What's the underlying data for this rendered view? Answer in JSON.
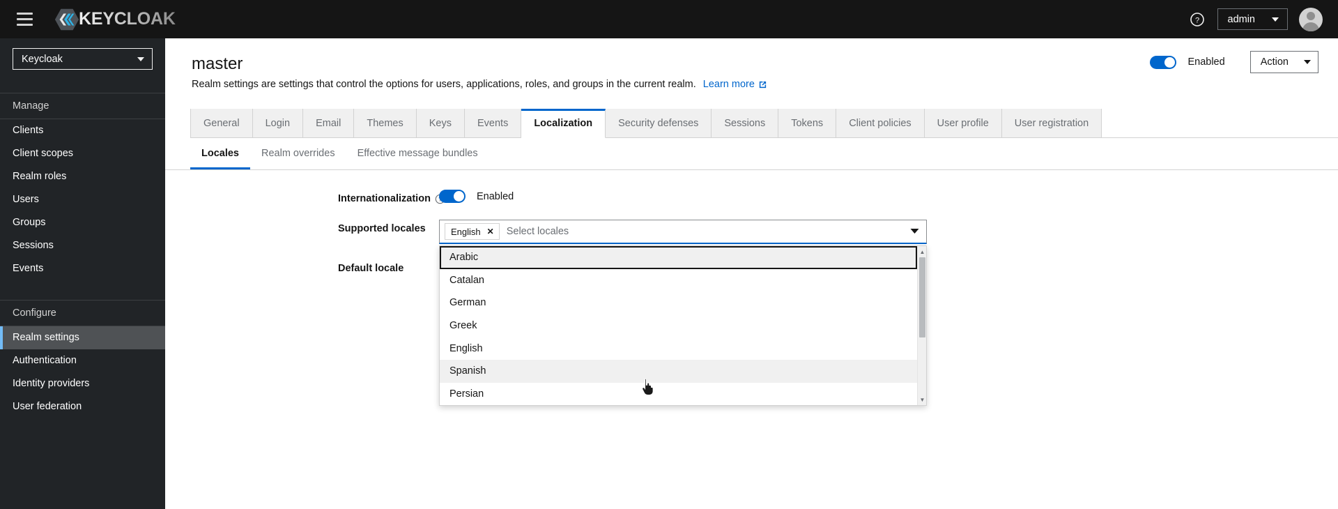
{
  "masthead": {
    "hamburger_icon": "hamburger-menu-icon",
    "brand_text": "KEYCLOAK",
    "brand_logo_icon": "keycloak-logo-icon",
    "help_icon": "help-circle-icon",
    "user_name": "admin",
    "user_caret_icon": "chevron-down-icon",
    "avatar_icon": "user-avatar-icon"
  },
  "sidebar": {
    "realm_selector": {
      "value": "Keycloak",
      "caret_icon": "chevron-down-icon"
    },
    "sections": [
      {
        "title": "Manage",
        "items": [
          {
            "label": "Clients",
            "active": false
          },
          {
            "label": "Client scopes",
            "active": false
          },
          {
            "label": "Realm roles",
            "active": false
          },
          {
            "label": "Users",
            "active": false
          },
          {
            "label": "Groups",
            "active": false
          },
          {
            "label": "Sessions",
            "active": false
          },
          {
            "label": "Events",
            "active": false
          }
        ]
      },
      {
        "title": "Configure",
        "items": [
          {
            "label": "Realm settings",
            "active": true
          },
          {
            "label": "Authentication",
            "active": false
          },
          {
            "label": "Identity providers",
            "active": false
          },
          {
            "label": "User federation",
            "active": false
          }
        ]
      }
    ]
  },
  "page": {
    "title": "master",
    "description": "Realm settings are settings that control the options for users, applications, roles, and groups in the current realm.",
    "learn_more_label": "Learn more",
    "learn_more_icon": "external-link-icon",
    "enabled_label": "Enabled",
    "enabled_state": true,
    "action_label": "Action",
    "action_caret_icon": "chevron-down-icon"
  },
  "tabs": [
    {
      "label": "General",
      "active": false
    },
    {
      "label": "Login",
      "active": false
    },
    {
      "label": "Email",
      "active": false
    },
    {
      "label": "Themes",
      "active": false
    },
    {
      "label": "Keys",
      "active": false
    },
    {
      "label": "Events",
      "active": false
    },
    {
      "label": "Localization",
      "active": true
    },
    {
      "label": "Security defenses",
      "active": false
    },
    {
      "label": "Sessions",
      "active": false
    },
    {
      "label": "Tokens",
      "active": false
    },
    {
      "label": "Client policies",
      "active": false
    },
    {
      "label": "User profile",
      "active": false
    },
    {
      "label": "User registration",
      "active": false
    }
  ],
  "subtabs": [
    {
      "label": "Locales",
      "active": true
    },
    {
      "label": "Realm overrides",
      "active": false
    },
    {
      "label": "Effective message bundles",
      "active": false
    }
  ],
  "form": {
    "internationalization": {
      "label": "Internationalization",
      "help_icon": "help-circle-icon",
      "toggle_state": true,
      "toggle_label": "Enabled"
    },
    "supported_locales": {
      "label": "Supported locales",
      "chips": [
        {
          "label": "English",
          "close_icon": "close-x-icon"
        }
      ],
      "placeholder": "Select locales",
      "toggle_icon": "caret-down-icon",
      "options": [
        {
          "label": "Arabic",
          "state": "focused"
        },
        {
          "label": "Catalan",
          "state": "normal"
        },
        {
          "label": "German",
          "state": "normal"
        },
        {
          "label": "Greek",
          "state": "normal"
        },
        {
          "label": "English",
          "state": "normal"
        },
        {
          "label": "Spanish",
          "state": "hovered"
        },
        {
          "label": "Persian",
          "state": "normal"
        }
      ],
      "scrollbar_up_icon": "caret-up-icon",
      "scrollbar_down_icon": "caret-down-icon"
    },
    "default_locale": {
      "label": "Default locale"
    }
  },
  "cursor": {
    "icon": "pointer-hand-cursor"
  },
  "colors": {
    "accent_blue": "#06c",
    "masthead_bg": "#151515",
    "sidebar_bg": "#212427",
    "active_nav_border": "#73bcf7"
  }
}
